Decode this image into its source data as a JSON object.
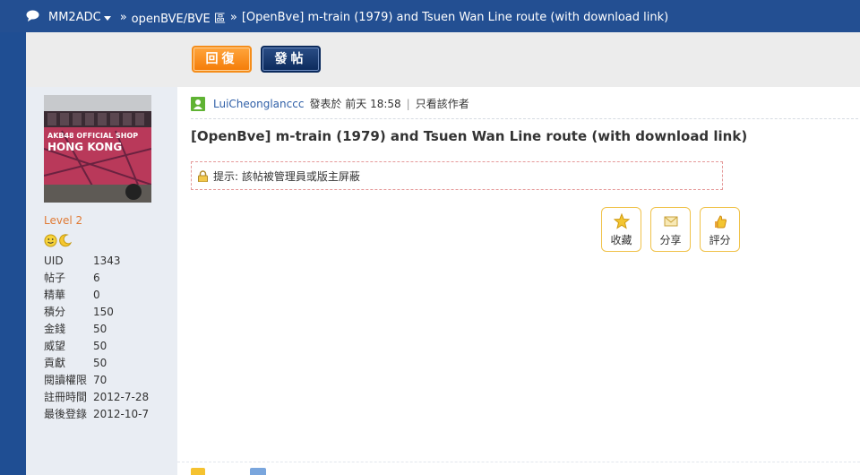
{
  "breadcrumb": {
    "site": "MM2ADC",
    "sep1": "»",
    "forum": "openBVE/BVE 區",
    "sep2": "»",
    "thread": "[OpenBve] m-train (1979) and Tsuen Wan Line route (with download link)"
  },
  "toolbar": {
    "reply_label": "回復",
    "post_label": "發帖"
  },
  "user": {
    "avatar_text_line1": "AKB48 OFFICIAL SHOP",
    "avatar_text_line2": "HONG KONG",
    "level": "Level 2",
    "stats": [
      {
        "key": "UID",
        "value": "1343"
      },
      {
        "key": "帖子",
        "value": "6"
      },
      {
        "key": "精華",
        "value": "0"
      },
      {
        "key": "積分",
        "value": "150"
      },
      {
        "key": "金錢",
        "value": "50"
      },
      {
        "key": "威望",
        "value": "50"
      },
      {
        "key": "貢獻",
        "value": "50"
      },
      {
        "key": "閱讀權限",
        "value": "70"
      },
      {
        "key": "註冊時間",
        "value": "2012-7-28"
      },
      {
        "key": "最後登錄",
        "value": "2012-10-7"
      }
    ]
  },
  "post": {
    "author": "LuiCheonglanccc",
    "posted_at": "發表於 前天 18:58",
    "pipe": "|",
    "only_author": "只看該作者",
    "title": "[OpenBve] m-train (1979) and Tsuen Wan Line route (with download link)",
    "notice": "提示: 該帖被管理員或版主屏蔽"
  },
  "actions": [
    {
      "label": "收藏",
      "icon": "star-icon"
    },
    {
      "label": "分享",
      "icon": "envelope-icon"
    },
    {
      "label": "評分",
      "icon": "thumbs-up-icon"
    }
  ],
  "colors": {
    "nav_bg": "#234f92",
    "author_link": "#2f5fa7",
    "level": "#e07a34",
    "reply_button": "#f47c08",
    "post_button": "#0b2a5c",
    "action_border": "#f0c24a"
  }
}
